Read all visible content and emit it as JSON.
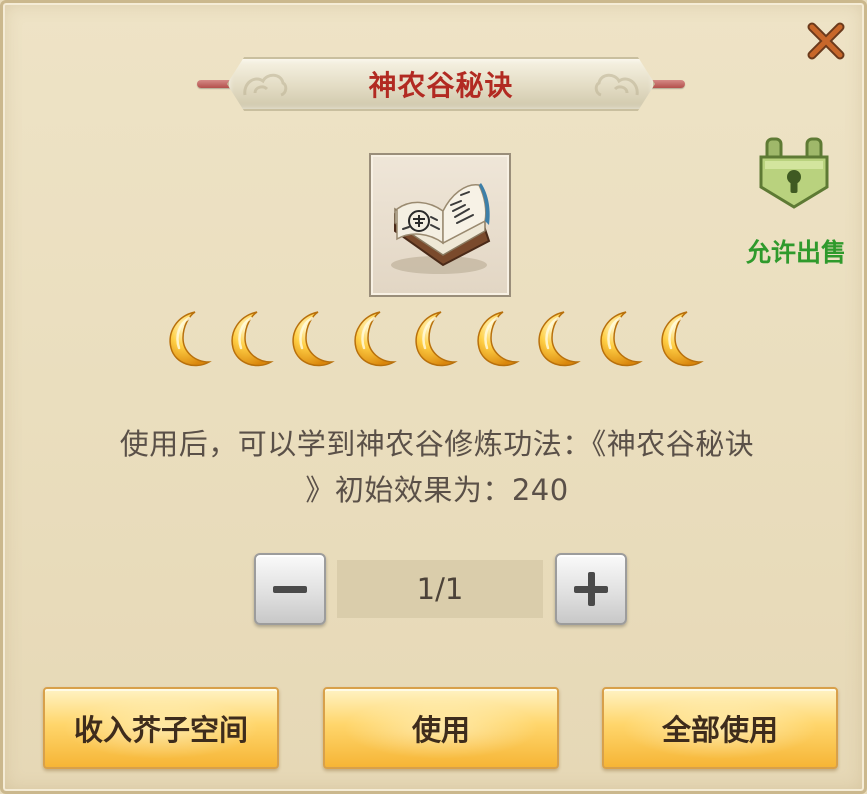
{
  "dialog": {
    "title": "神农谷秘诀",
    "close_icon": "close-icon",
    "accent_color": "#b22a22"
  },
  "item": {
    "icon": "book-icon",
    "rating": {
      "icon": "crescent-moon-icon",
      "count": 9
    }
  },
  "sell": {
    "icon": "sellable-unlocked-icon",
    "label": "允许出售",
    "color": "#2f9a2c"
  },
  "description": {
    "line1": "使用后，可以学到神农谷修炼功法：《神农谷秘诀",
    "line2": "》初始效果为：240"
  },
  "quantity": {
    "value": "1/1",
    "minus_icon": "minus-icon",
    "plus_icon": "plus-icon"
  },
  "actions": {
    "store_label": "收入芥子空间",
    "use_label": "使用",
    "use_all_label": "全部使用"
  }
}
